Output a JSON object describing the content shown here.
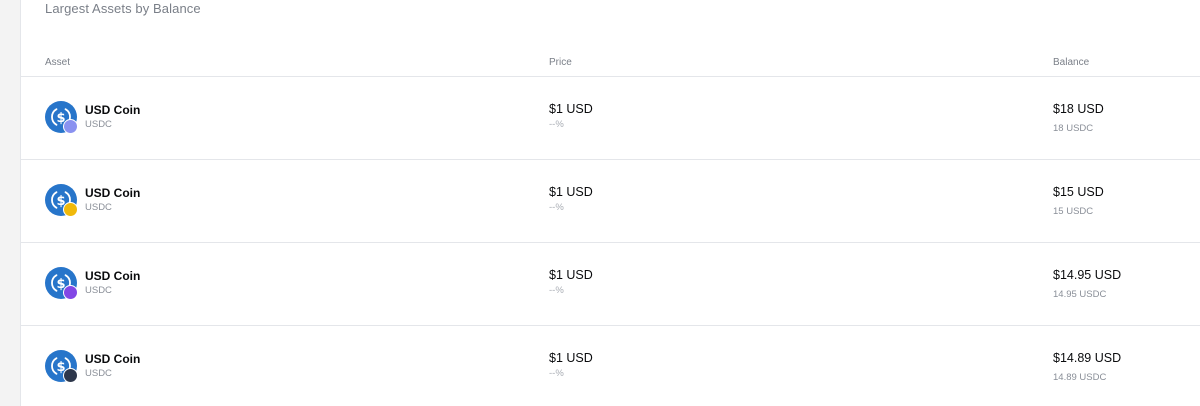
{
  "section": {
    "title": "Largest Assets by Balance"
  },
  "table": {
    "headers": {
      "asset": "Asset",
      "price": "Price",
      "balance": "Balance"
    },
    "rows": [
      {
        "name": "USD Coin",
        "ticker": "USDC",
        "price": "$1 USD",
        "change": "--%",
        "balance": "$18 USD",
        "balance_native": "18 USDC",
        "coin_icon": "usdc-icon",
        "chain_icon": "ethereum-icon",
        "chain_color": "#8a92f0"
      },
      {
        "name": "USD Coin",
        "ticker": "USDC",
        "price": "$1 USD",
        "change": "--%",
        "balance": "$15 USD",
        "balance_native": "15 USDC",
        "coin_icon": "usdc-icon",
        "chain_icon": "bnb-chain-icon",
        "chain_color": "#f0b90b"
      },
      {
        "name": "USD Coin",
        "ticker": "USDC",
        "price": "$1 USD",
        "change": "--%",
        "balance": "$14.95 USD",
        "balance_native": "14.95 USDC",
        "coin_icon": "usdc-icon",
        "chain_icon": "polygon-icon",
        "chain_color": "#8247e5"
      },
      {
        "name": "USD Coin",
        "ticker": "USDC",
        "price": "$1 USD",
        "change": "--%",
        "balance": "$14.89 USD",
        "balance_native": "14.89 USDC",
        "coin_icon": "usdc-icon",
        "chain_icon": "arbitrum-icon",
        "chain_color": "#2d374b"
      }
    ]
  },
  "colors": {
    "usdc_blue": "#2775ca",
    "divider": "#e4e6ea",
    "muted_text": "#8a8f98"
  }
}
